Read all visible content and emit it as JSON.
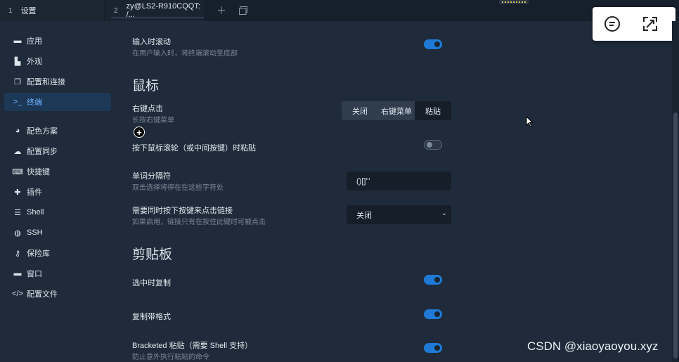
{
  "tabs": [
    {
      "num": "1",
      "label": "设置"
    },
    {
      "num": "2",
      "label": "zy@LS2-R910CQQT: /..."
    }
  ],
  "sidebar": {
    "items": [
      {
        "label": "应用",
        "icon": "window-icon"
      },
      {
        "label": "外观",
        "icon": "brush-icon"
      },
      {
        "label": "配置和连接",
        "icon": "copy-icon"
      },
      {
        "label": "终端",
        "icon": "terminal-icon",
        "active": true
      },
      {
        "label": "配色方案",
        "icon": "palette-icon"
      },
      {
        "label": "配置同步",
        "icon": "cloud-icon"
      },
      {
        "label": "快捷键",
        "icon": "keyboard-icon"
      },
      {
        "label": "插件",
        "icon": "puzzle-icon"
      },
      {
        "label": "Shell",
        "icon": "list-icon"
      },
      {
        "label": "SSH",
        "icon": "globe-icon"
      },
      {
        "label": "保险库",
        "icon": "key-icon"
      },
      {
        "label": "窗口",
        "icon": "window-icon"
      },
      {
        "label": "配置文件",
        "icon": "code-icon"
      }
    ]
  },
  "main": {
    "scroll_on_input": {
      "label": "输入时滚动",
      "desc": "在用户输入时，将终端滚动至底部",
      "on": true
    },
    "mouse_title": "鼠标",
    "right_click": {
      "label": "右键点击",
      "desc": "长按右键菜单",
      "options": [
        "关闭",
        "右键菜单",
        "粘贴"
      ],
      "selected": "粘贴"
    },
    "middle_paste": {
      "label": "按下鼠标滚轮（或中间按键）时粘贴",
      "on": false
    },
    "word_sep": {
      "label": "单词分隔符",
      "desc": "双击选择将停在在这些字符处",
      "value": "()[]'\""
    },
    "link_modifier": {
      "label": "需要同时按下按键来点击链接",
      "desc": "如果启用，链接只有在按住此键时可被点击",
      "value": "关闭"
    },
    "clipboard_title": "剪贴板",
    "copy_on_select": {
      "label": "选中时复制",
      "on": true
    },
    "copy_formatting": {
      "label": "复制带格式",
      "on": true
    },
    "bracketed_paste": {
      "label": "Bracketed 粘贴（需要 Shell 支持）",
      "desc": "防止意外执行粘贴的命令",
      "on": true
    }
  },
  "watermark": "CSDN @xiaoyaoyou.xyz",
  "colors": {
    "accent": "#1e7ad6",
    "active_text": "#6fb3ff",
    "background": "#1f2b3a"
  }
}
